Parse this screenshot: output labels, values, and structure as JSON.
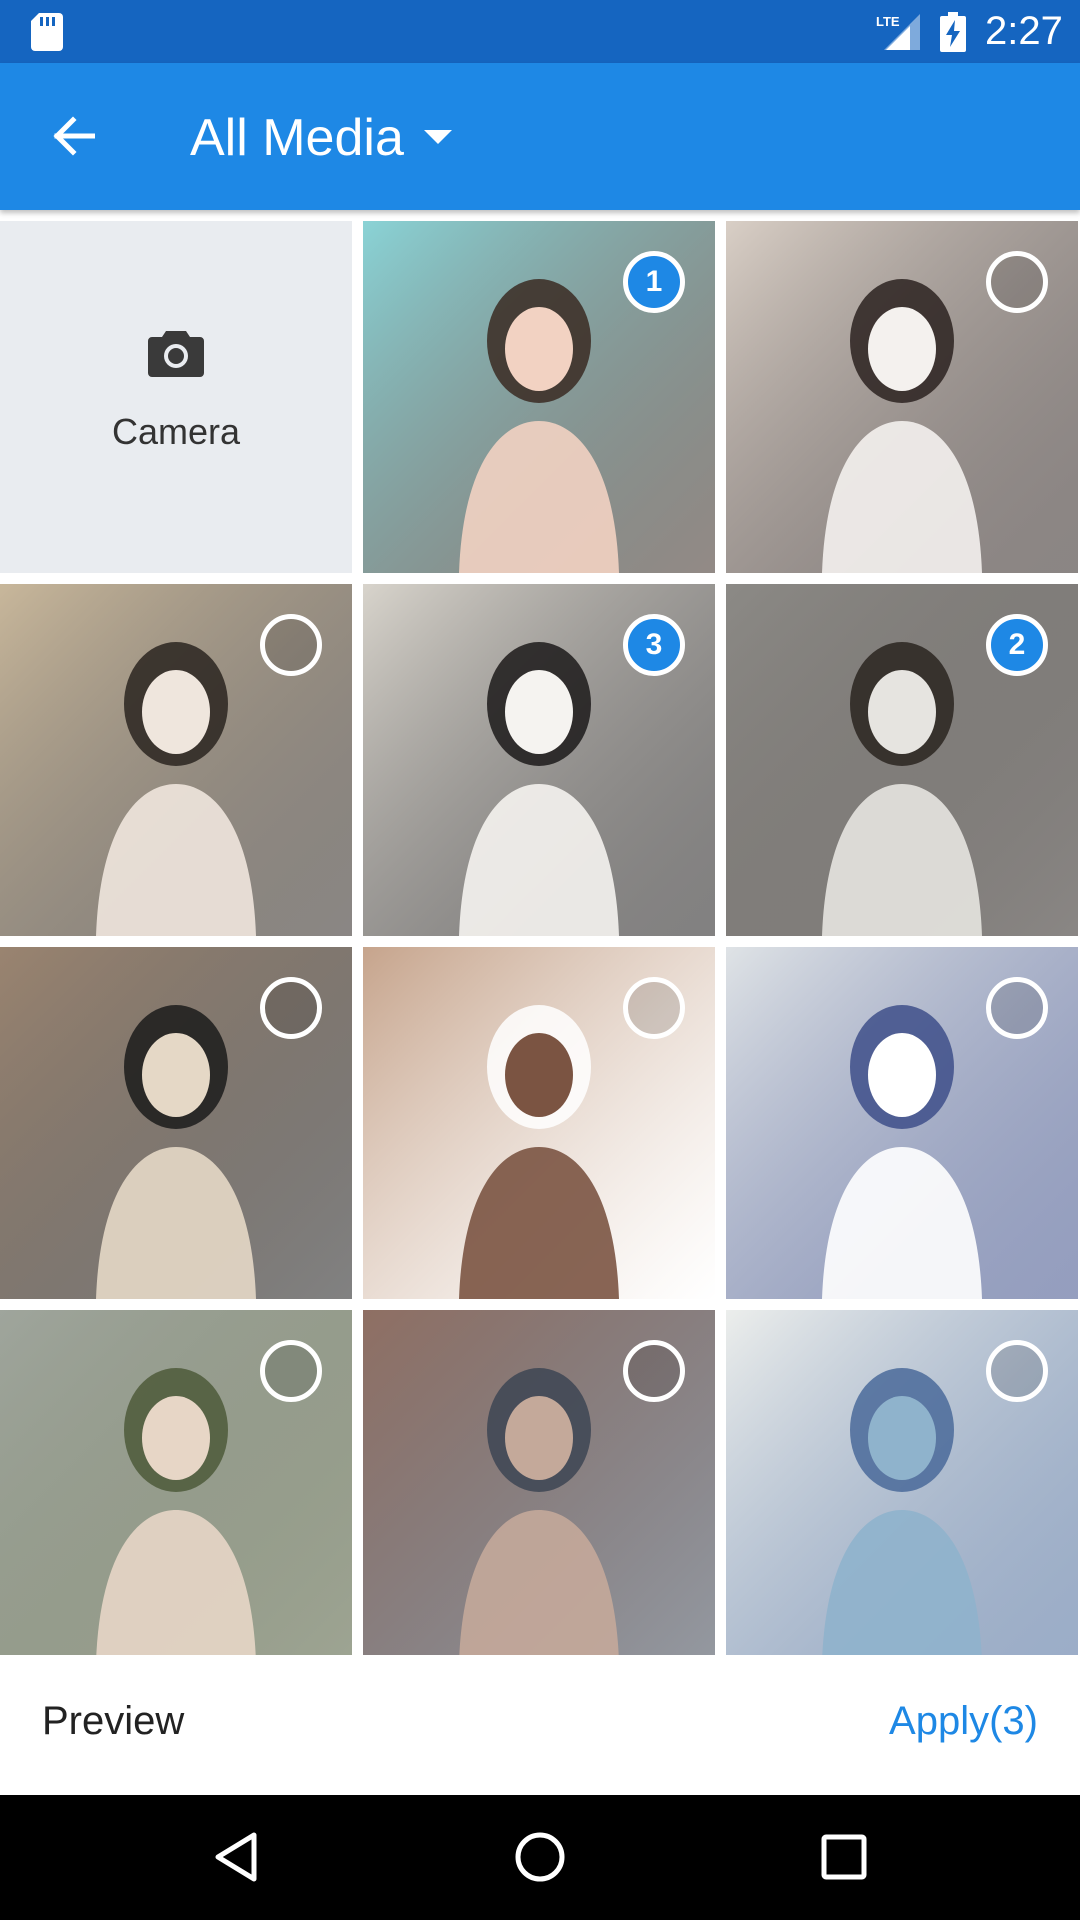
{
  "status_bar": {
    "network": "LTE",
    "time": "2:27",
    "icons": [
      "sd-card-icon",
      "signal-icon",
      "battery-charging-icon"
    ]
  },
  "toolbar": {
    "back_icon": "arrow-back-icon",
    "title": "All Media",
    "dropdown_icon": "caret-down-icon"
  },
  "grid": {
    "camera": {
      "label": "Camera",
      "icon": "camera-icon"
    },
    "photos": [
      {
        "name": "photo-1",
        "selected": true,
        "order": "1",
        "palette": [
          "#8ad3d6",
          "#3a2a22",
          "#f2d2c2"
        ]
      },
      {
        "name": "photo-2",
        "selected": false,
        "order": "",
        "palette": [
          "#d9cfc6",
          "#2c2220",
          "#f4f1ee"
        ]
      },
      {
        "name": "photo-3",
        "selected": false,
        "order": "",
        "palette": [
          "#c8b79b",
          "#2a2420",
          "#efe6dd"
        ]
      },
      {
        "name": "photo-4",
        "selected": true,
        "order": "3",
        "palette": [
          "#d8d4cc",
          "#1c1a1a",
          "#f5f3f0"
        ]
      },
      {
        "name": "photo-5",
        "selected": true,
        "order": "2",
        "palette": [
          "#8c8a86",
          "#2a2420",
          "#e6e4e0"
        ]
      },
      {
        "name": "photo-6",
        "selected": false,
        "order": "",
        "palette": [
          "#9a8470",
          "#1b1b1b",
          "#e5d8c6"
        ]
      },
      {
        "name": "photo-7",
        "selected": false,
        "order": "",
        "palette": [
          "#c6a48c",
          "#ffffff",
          "#7b5442"
        ]
      },
      {
        "name": "photo-8",
        "selected": false,
        "order": "",
        "palette": [
          "#dfe3e6",
          "#3e4f8a",
          "#ffffff"
        ]
      },
      {
        "name": "photo-9",
        "selected": false,
        "order": "",
        "palette": [
          "#9fa59c",
          "#4e5a3a",
          "#e7d6c6"
        ]
      },
      {
        "name": "photo-10",
        "selected": false,
        "order": "",
        "palette": [
          "#8f6f63",
          "#3d4553",
          "#c4a99a"
        ]
      },
      {
        "name": "photo-11",
        "selected": false,
        "order": "",
        "palette": [
          "#eceeec",
          "#4a6a9a",
          "#8fb3cc"
        ]
      }
    ]
  },
  "bottom_bar": {
    "preview_label": "Preview",
    "apply_label": "Apply(3)"
  },
  "nav_bar": {
    "buttons": [
      "back-triangle-icon",
      "home-circle-icon",
      "recents-square-icon"
    ]
  },
  "colors": {
    "status_bar": "#1565c0",
    "toolbar": "#1e88e5",
    "accent": "#1e88e5"
  }
}
